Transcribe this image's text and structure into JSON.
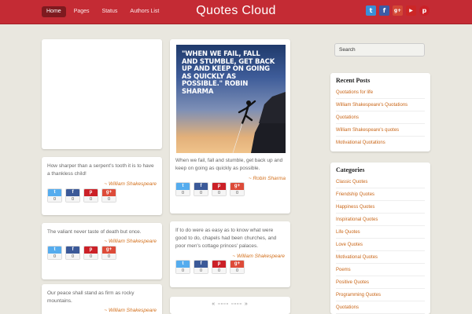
{
  "header": {
    "nav": [
      "Home",
      "Pages",
      "Status",
      "Authors List"
    ],
    "title": "Quotes Cloud",
    "social": [
      {
        "name": "twitter-icon",
        "glyph": "t",
        "color": "#3a8fd8"
      },
      {
        "name": "facebook-icon",
        "glyph": "f",
        "color": "#3b5ba5"
      },
      {
        "name": "google-plus-icon",
        "glyph": "g+",
        "color": "#d34836"
      },
      {
        "name": "youtube-icon",
        "glyph": "▶",
        "color": "#cc2626"
      },
      {
        "name": "pinterest-icon",
        "glyph": "p",
        "color": "#cb2027"
      }
    ]
  },
  "share": {
    "tw": "t",
    "fb": "f",
    "pin": "p",
    "gp": "g+",
    "count": "0"
  },
  "col1": {
    "q1": {
      "text": "How sharper than a serpent's tooth it is to have a thankless child!",
      "author": "~ William Shakespeare"
    },
    "q2": {
      "text": "The valiant never taste of death but once.",
      "author": "~ William Shakespeare"
    },
    "q3": {
      "text": "Our peace shall stand as firm as rocky mountains.",
      "author": "~ William Shakespeare"
    }
  },
  "col2": {
    "image_text": "\"WHEN WE FAIL, FALL AND STUMBLE, GET BACK UP AND KEEP ON GOING AS QUICKLY AS POSSIBLE.\" ROBIN SHARMA",
    "q1": {
      "text": "When we fail, fall and stumble, get back up and keep on going as quickly as possible.",
      "author": "~ Robin Sharma"
    },
    "q2": {
      "text": "If to do were as easy as to know what were good to do, chapels had been churches, and poor men's cottage princes' palaces.",
      "author": "~ William Shakespeare"
    },
    "pager": "« ▫▫▫▫ ▫▫▫▫ »"
  },
  "sidebar": {
    "search_placeholder": "Search",
    "recent_title": "Recent Posts",
    "recent": [
      "Quotations for life",
      "William Shakespeare's Quotations",
      "Quotations",
      "William Shakespeare's quotes",
      "Motivational Quotations"
    ],
    "categories_title": "Categories",
    "categories": [
      "Classic Quotes",
      "Friendship Quotes",
      "Happiness Quotes",
      "Inspirational Quotes",
      "Life Quotes",
      "Love Quotes",
      "Motivational Quotes",
      "Poems",
      "Positive Quotes",
      "Programming Quotes",
      "Quotations"
    ]
  },
  "colors": {
    "brand_red": "#c42b34",
    "accent_orange": "#d3701c",
    "twitter": "#55acee",
    "facebook": "#3b5998",
    "pinterest": "#cb2027",
    "gplus": "#dd4b39"
  }
}
